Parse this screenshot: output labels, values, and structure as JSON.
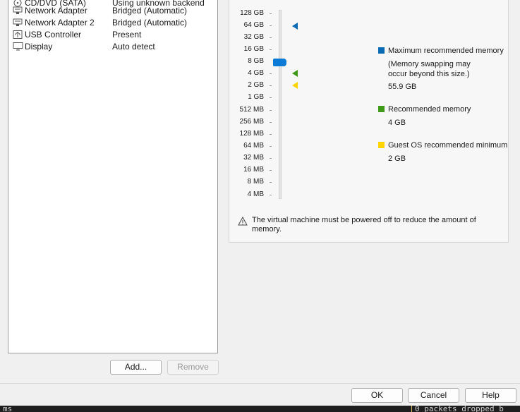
{
  "devices": [
    {
      "icon": "cd-dvd-icon",
      "name": "CD/DVD (SATA)",
      "summary": "Using unknown backend"
    },
    {
      "icon": "network-adapter-icon",
      "name": "Network Adapter",
      "summary": "Bridged (Automatic)"
    },
    {
      "icon": "network-adapter-icon",
      "name": "Network Adapter 2",
      "summary": "Bridged (Automatic)"
    },
    {
      "icon": "usb-controller-icon",
      "name": "USB Controller",
      "summary": "Present"
    },
    {
      "icon": "display-icon",
      "name": "Display",
      "summary": "Auto detect"
    }
  ],
  "device_buttons": {
    "add": "Add...",
    "remove": "Remove"
  },
  "memory": {
    "scale": [
      "128 GB",
      "64 GB",
      "32 GB",
      "16 GB",
      "8 GB",
      "4 GB",
      "2 GB",
      "1 GB",
      "512 MB",
      "256 MB",
      "128 MB",
      "64 MB",
      "32 MB",
      "16 MB",
      "8 MB",
      "4 MB"
    ],
    "current": "8 GB",
    "legend": {
      "max": {
        "title": "Maximum recommended memory",
        "note": "(Memory swapping may\noccur beyond this size.)",
        "value": "55.9 GB",
        "color": "#0a6ab4"
      },
      "recommended": {
        "title": "Recommended memory",
        "value": "4 GB",
        "color": "#3f9b17"
      },
      "minimum": {
        "title": "Guest OS recommended minimum",
        "value": "2 GB",
        "color": "#ffd400"
      }
    },
    "warning": "The virtual machine must be powered off to reduce the amount of memory."
  },
  "dialog_buttons": {
    "ok": "OK",
    "cancel": "Cancel",
    "help": "Help"
  },
  "terminal": {
    "left": "ms",
    "right": "0 packets dropped b"
  }
}
